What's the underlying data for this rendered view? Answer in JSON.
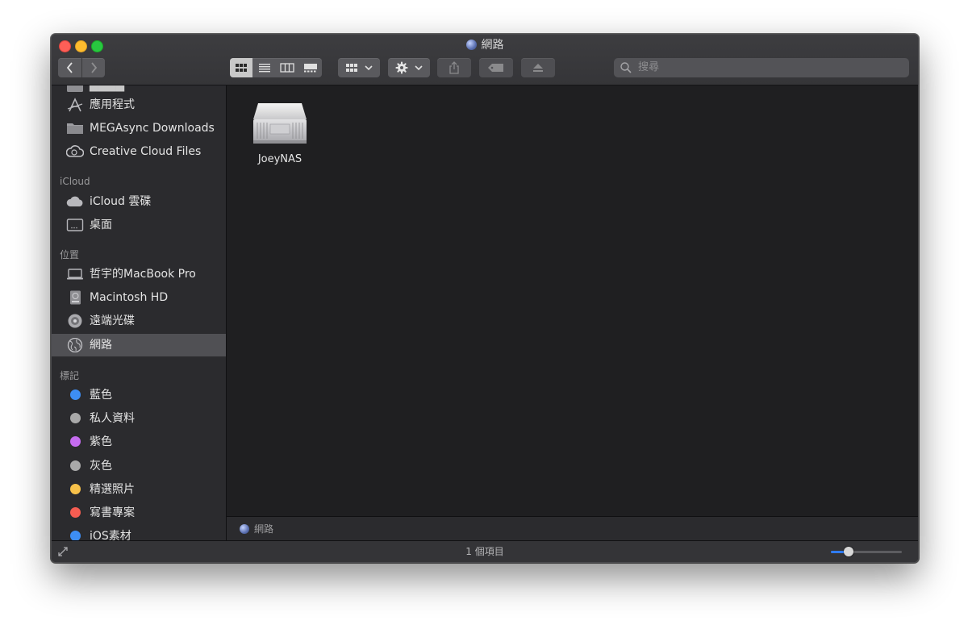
{
  "window": {
    "title": "網路"
  },
  "toolbar": {
    "search_placeholder": "搜尋",
    "view_active": "icon"
  },
  "sidebar": {
    "favorites_partial": "",
    "favorites": [
      {
        "label": "應用程式",
        "icon": "applications-icon"
      },
      {
        "label": "MEGAsync Downloads",
        "icon": "folder-icon"
      },
      {
        "label": "Creative Cloud Files",
        "icon": "creative-cloud-icon"
      }
    ],
    "icloud_header": "iCloud",
    "icloud": [
      {
        "label": "iCloud 雲碟",
        "icon": "icloud-drive-icon"
      },
      {
        "label": "桌面",
        "icon": "desktop-icon"
      }
    ],
    "locations_header": "位置",
    "locations": [
      {
        "label": "哲宇的MacBook Pro",
        "icon": "laptop-icon"
      },
      {
        "label": "Macintosh HD",
        "icon": "hard-drive-icon"
      },
      {
        "label": "遠端光碟",
        "icon": "optical-disc-icon"
      },
      {
        "label": "網路",
        "icon": "network-globe-icon"
      }
    ],
    "tags_header": "標記",
    "tags": [
      {
        "label": "藍色",
        "color": "#3d8ef5"
      },
      {
        "label": "私人資料",
        "color": "#a9a9a9"
      },
      {
        "label": "紫色",
        "color": "#c56cf0"
      },
      {
        "label": "灰色",
        "color": "#a9a9a9"
      },
      {
        "label": "精選照片",
        "color": "#f7c14a"
      },
      {
        "label": "寫書專案",
        "color": "#f55d52"
      },
      {
        "label": "iOS素材",
        "color": "#3d8ef5"
      }
    ]
  },
  "content": {
    "items": [
      {
        "label": "JoeyNAS",
        "icon": "nas-server-icon"
      }
    ]
  },
  "pathbar": {
    "label": "網路"
  },
  "status": {
    "item_count": "1 個項目",
    "zoom_fraction": 0.25
  }
}
